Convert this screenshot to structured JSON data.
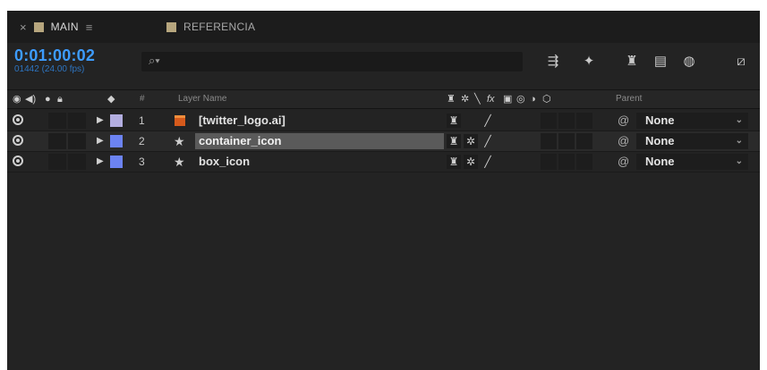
{
  "tabs": [
    {
      "label": "MAIN",
      "color": "#b7a67e",
      "active": true
    },
    {
      "label": "REFERENCIA",
      "color": "#b7a67e",
      "active": false
    }
  ],
  "timecode": {
    "main": "0:01:00:02",
    "frames": "01442 (24.00 fps)"
  },
  "search": {
    "placeholder": ""
  },
  "headers": {
    "num": "#",
    "layer_name": "Layer Name",
    "parent": "Parent"
  },
  "layers": [
    {
      "num": "1",
      "name": "[twitter_logo.ai]",
      "label_color": "#b3aee0",
      "type_icon": "ai-file-icon",
      "parent": "None",
      "selected": false
    },
    {
      "num": "2",
      "name": "container_icon",
      "label_color": "#6c83f2",
      "type_icon": "star-shape-icon",
      "parent": "None",
      "selected": true
    },
    {
      "num": "3",
      "name": "box_icon",
      "label_color": "#6c83f2",
      "type_icon": "star-shape-icon",
      "parent": "None",
      "selected": false
    }
  ],
  "colors": {
    "accent_timecode": "#3d9cff",
    "panel_bg": "#232323"
  }
}
